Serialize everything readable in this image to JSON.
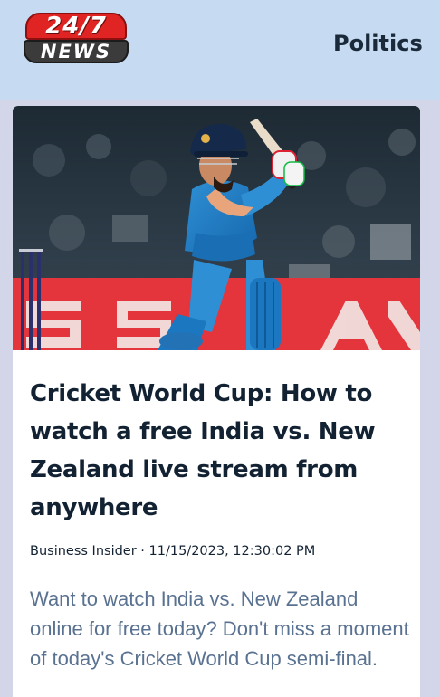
{
  "brand": {
    "logo_top": "24/7",
    "logo_bottom": "NEWS"
  },
  "nav": {
    "items": [
      "Politics"
    ]
  },
  "article": {
    "image_alt": "Cricket batsman in blue India kit playing a shot",
    "headline": "Cricket World Cup: How to watch a free India vs. New Zealand live stream from anywhere",
    "source": "Business Insider",
    "separator": " · ",
    "timestamp": "11/15/2023, 12:30:02 PM",
    "summary": "Want to watch India vs. New Zealand online for free today? Don't miss a moment of today's Cricket World Cup semi-final."
  }
}
